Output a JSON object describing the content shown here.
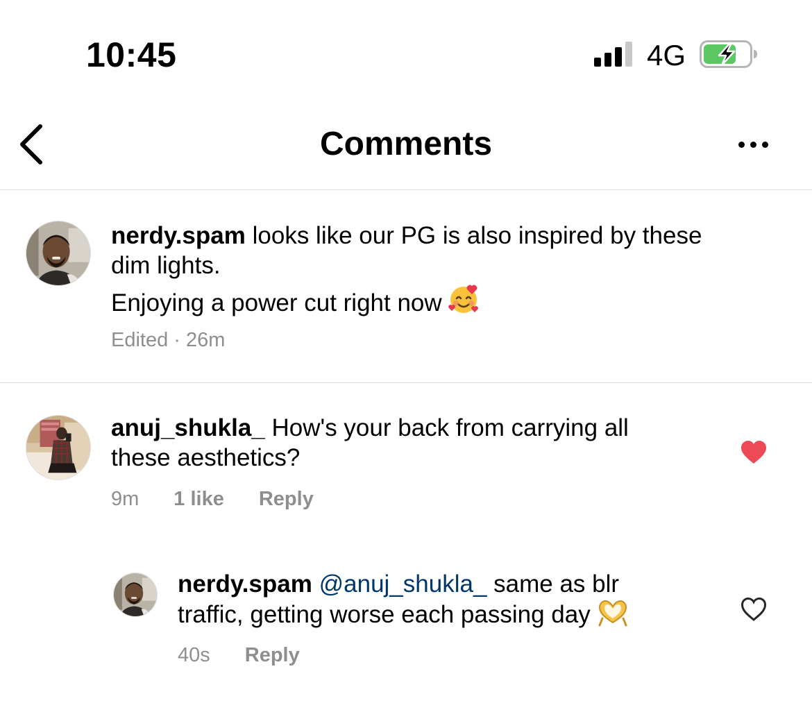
{
  "status": {
    "time": "10:45",
    "network": "4G"
  },
  "header": {
    "title": "Comments"
  },
  "comments": [
    {
      "username": "nerdy.spam",
      "text_line1": "looks like our PG is also inspired by these",
      "text_line2": "dim lights.",
      "text_line3": "Enjoying a power cut right now",
      "emoji": "smiling-face-with-hearts",
      "meta": "Edited · 26m"
    },
    {
      "username": "anuj_shukla_",
      "text_line1": "How's your back from carrying all",
      "text_line2": "these aesthetics?",
      "time": "9m",
      "likes": "1 like",
      "reply_label": "Reply",
      "liked": true
    },
    {
      "username": "nerdy.spam",
      "mention": "@anuj_shukla_",
      "text_line1": "same as blr",
      "text_line2": "traffic, getting worse each passing day",
      "emoji": "heart-hands",
      "time": "40s",
      "reply_label": "Reply",
      "liked": false
    }
  ],
  "colors": {
    "liked_heart": "#ed4956",
    "meta_text": "#8e8e8e",
    "mention": "#00376b",
    "battery_fill": "#5cc864"
  }
}
